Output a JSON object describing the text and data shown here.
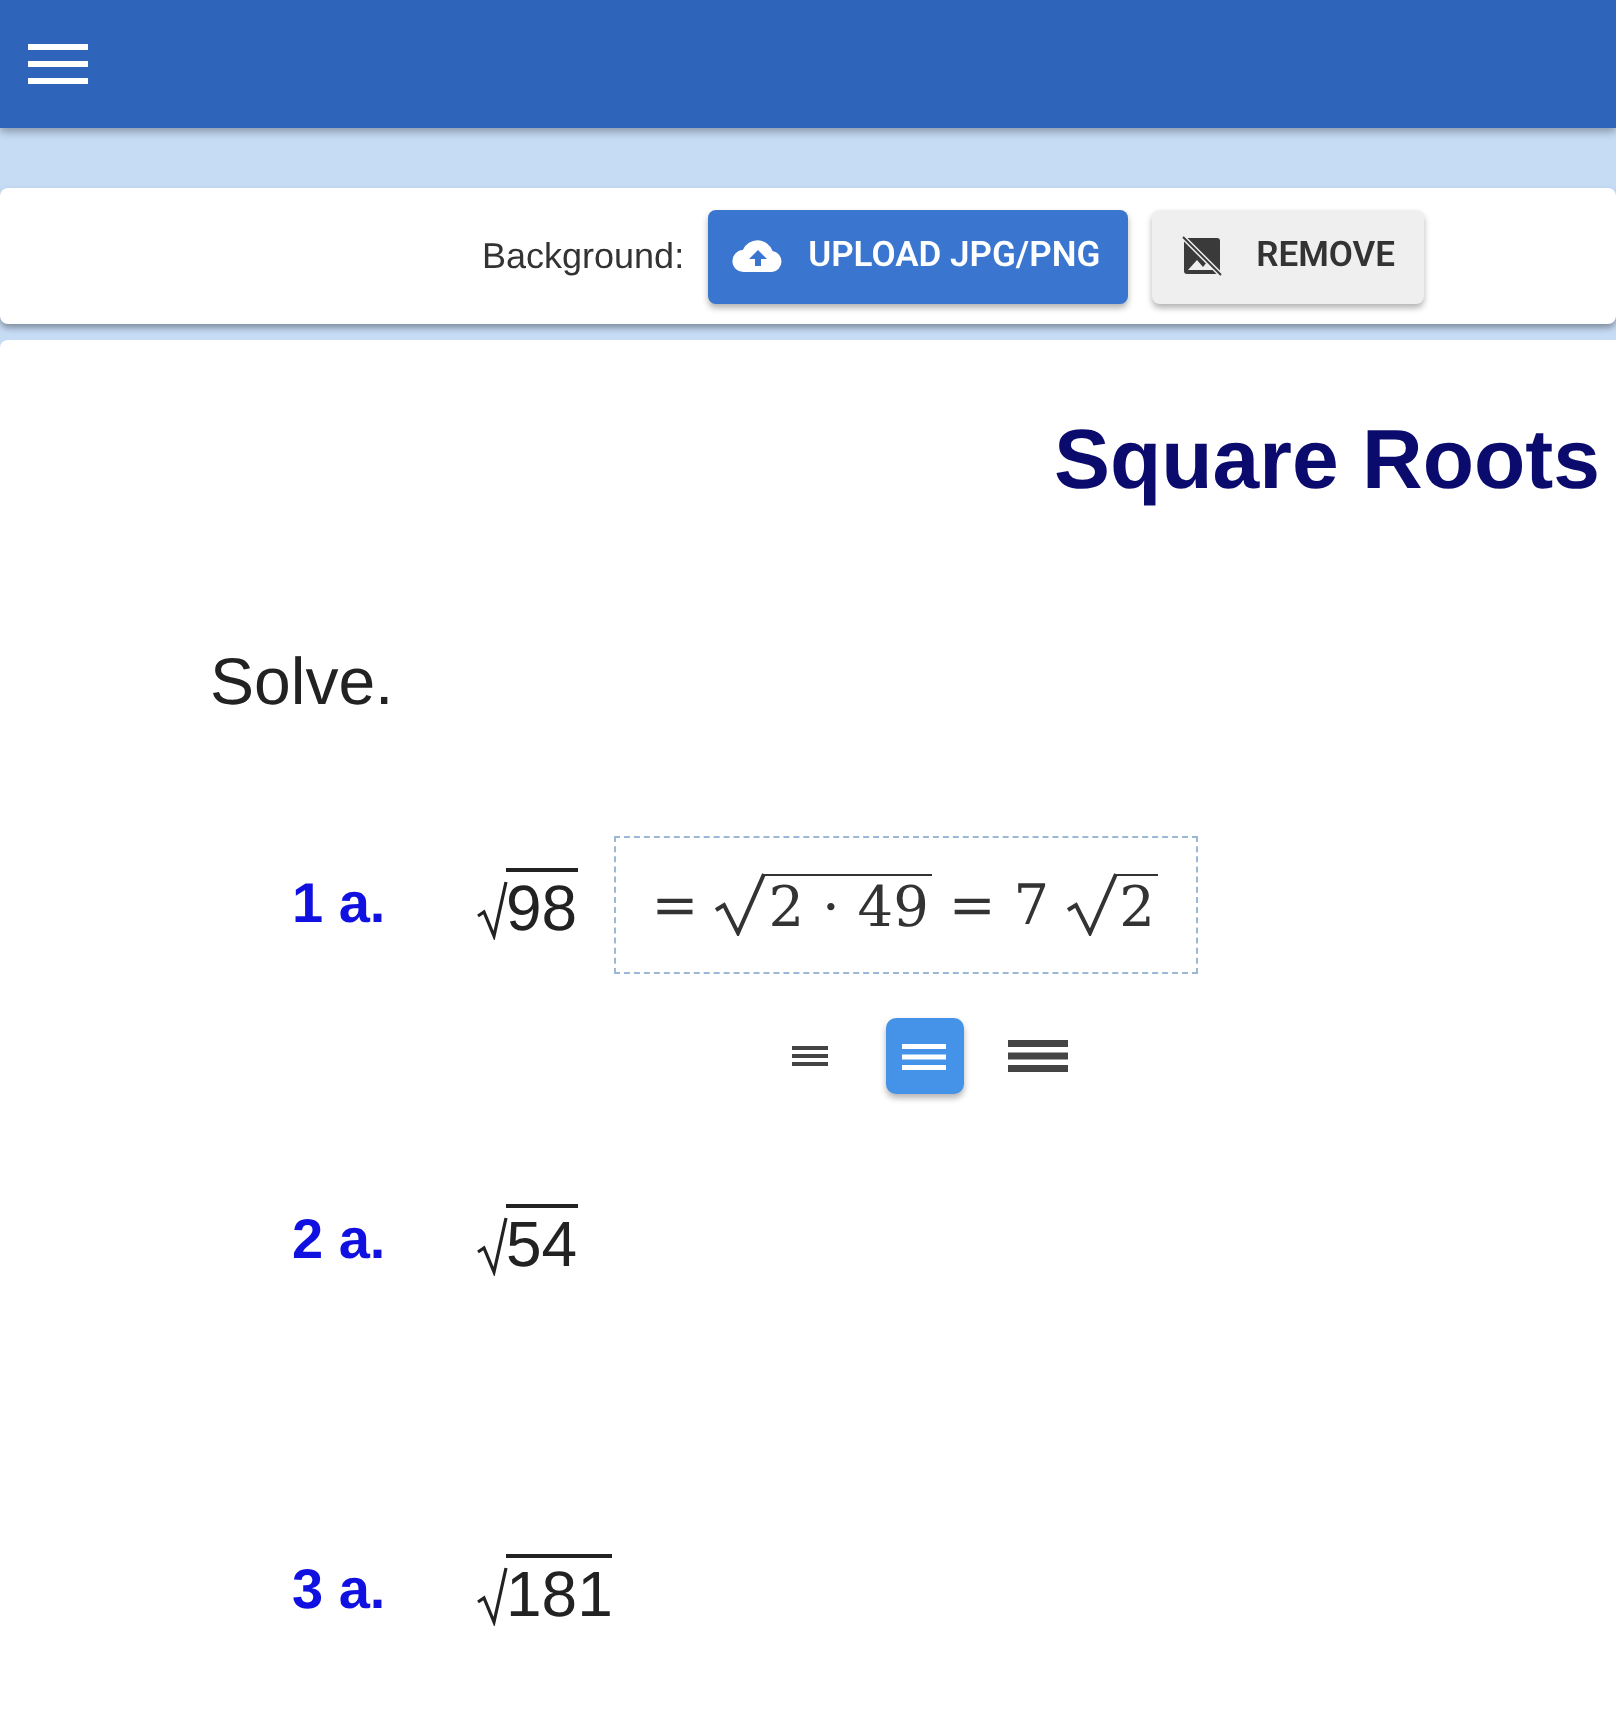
{
  "toolbar": {
    "label": "Background:",
    "buttons": [
      {
        "kind": "upload",
        "label": "UPLOAD JPG/PNG"
      },
      {
        "kind": "remove",
        "label": "REMOVE"
      }
    ]
  },
  "title": "Square Roots",
  "instruction": "Solve.",
  "problems": [
    {
      "label": "1 a.",
      "radicand": "98",
      "answer": [
        {
          "kind": "text",
          "text": "="
        },
        {
          "kind": "sqrt",
          "text": "2 · 49"
        },
        {
          "kind": "text",
          "text": "= 7"
        },
        {
          "kind": "sqrt",
          "text": "2"
        }
      ],
      "size_options": [
        {
          "kind": "small",
          "selected": false
        },
        {
          "kind": "medium",
          "selected": true
        },
        {
          "kind": "large",
          "selected": false
        }
      ]
    },
    {
      "label": "2 a.",
      "radicand": "54"
    },
    {
      "label": "3 a.",
      "radicand": "181"
    }
  ]
}
